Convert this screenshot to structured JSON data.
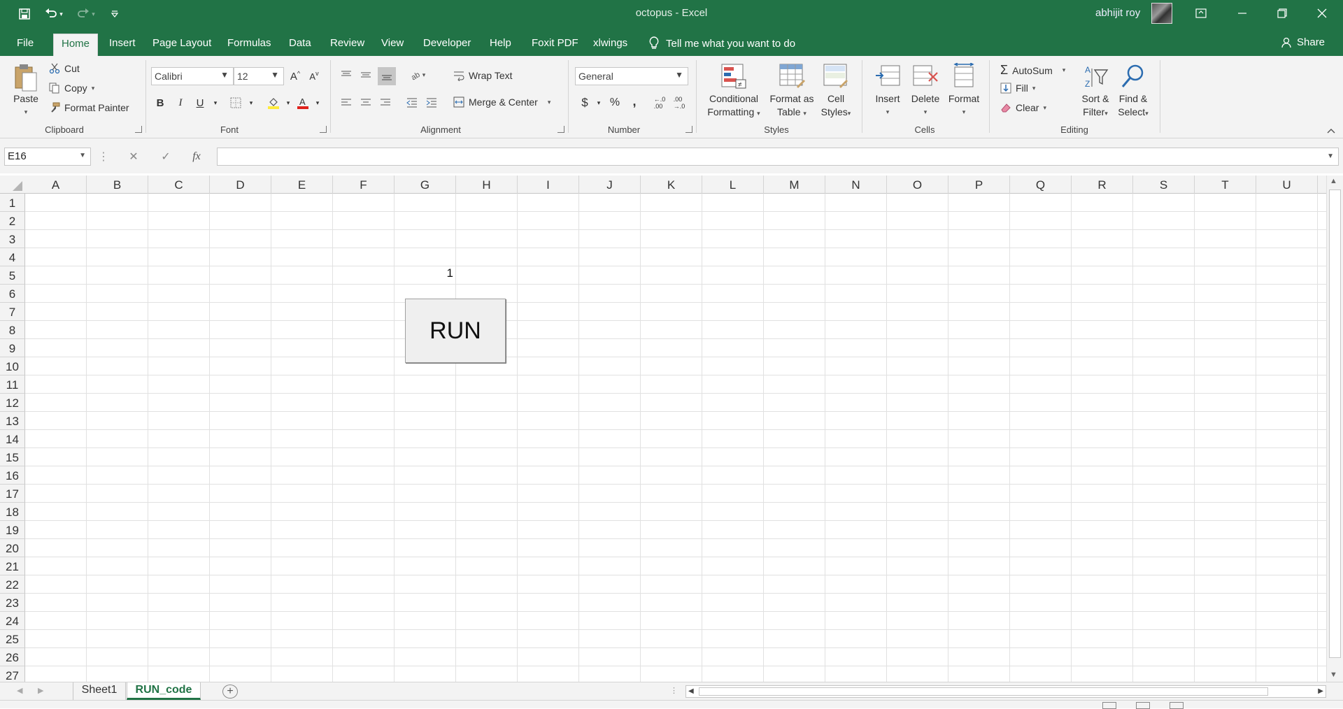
{
  "titlebar": {
    "doc_title": "octopus  -  Excel",
    "user": "abhijit roy",
    "quick_access": [
      "save-icon",
      "undo-icon",
      "redo-icon",
      "customize-icon"
    ]
  },
  "tabs": [
    "File",
    "Home",
    "Insert",
    "Page Layout",
    "Formulas",
    "Data",
    "Review",
    "View",
    "Developer",
    "Help",
    "Foxit PDF",
    "xlwings"
  ],
  "active_tab": "Home",
  "tell_me": "Tell me what you want to do",
  "share": "Share",
  "ribbon": {
    "clipboard": {
      "label": "Clipboard",
      "paste": "Paste",
      "cut": "Cut",
      "copy": "Copy",
      "format_painter": "Format Painter"
    },
    "font": {
      "label": "Font",
      "name": "Calibri",
      "size": "12",
      "bold": "B",
      "italic": "I",
      "underline": "U",
      "grow": "A",
      "shrink": "A"
    },
    "alignment": {
      "label": "Alignment",
      "wrap_text": "Wrap Text",
      "merge_center": "Merge & Center"
    },
    "number": {
      "label": "Number",
      "format": "General",
      "currency": "$",
      "percent": "%",
      "comma": ","
    },
    "styles": {
      "label": "Styles",
      "conditional": [
        "Conditional",
        "Formatting"
      ],
      "format_table": [
        "Format as",
        "Table"
      ],
      "cell_styles": [
        "Cell",
        "Styles"
      ]
    },
    "cells": {
      "label": "Cells",
      "insert": "Insert",
      "delete": "Delete",
      "format": "Format"
    },
    "editing": {
      "label": "Editing",
      "autosum": "AutoSum",
      "fill": "Fill",
      "clear": "Clear",
      "sort_filter": [
        "Sort &",
        "Filter"
      ],
      "find_select": [
        "Find &",
        "Select"
      ]
    }
  },
  "formula_bar": {
    "name_box": "E16",
    "fx": "fx",
    "formula": ""
  },
  "columns": [
    "A",
    "B",
    "C",
    "D",
    "E",
    "F",
    "G",
    "H",
    "I",
    "J",
    "K",
    "L",
    "M",
    "N",
    "O",
    "P",
    "Q",
    "R",
    "S",
    "T",
    "U"
  ],
  "rows": [
    "1",
    "2",
    "3",
    "4",
    "5",
    "6",
    "7",
    "8",
    "9",
    "10",
    "11",
    "12",
    "13",
    "14",
    "15",
    "16",
    "17",
    "18",
    "19",
    "20",
    "21",
    "22",
    "23",
    "24",
    "25",
    "26",
    "27"
  ],
  "cells": {
    "G5": "1"
  },
  "run_button": "RUN",
  "sheets": [
    "Sheet1",
    "RUN_code"
  ],
  "active_sheet": "RUN_code",
  "colors": {
    "brand": "#217346",
    "ribbon_bg": "#f3f3f3",
    "grid_line": "#e1e1e1"
  }
}
